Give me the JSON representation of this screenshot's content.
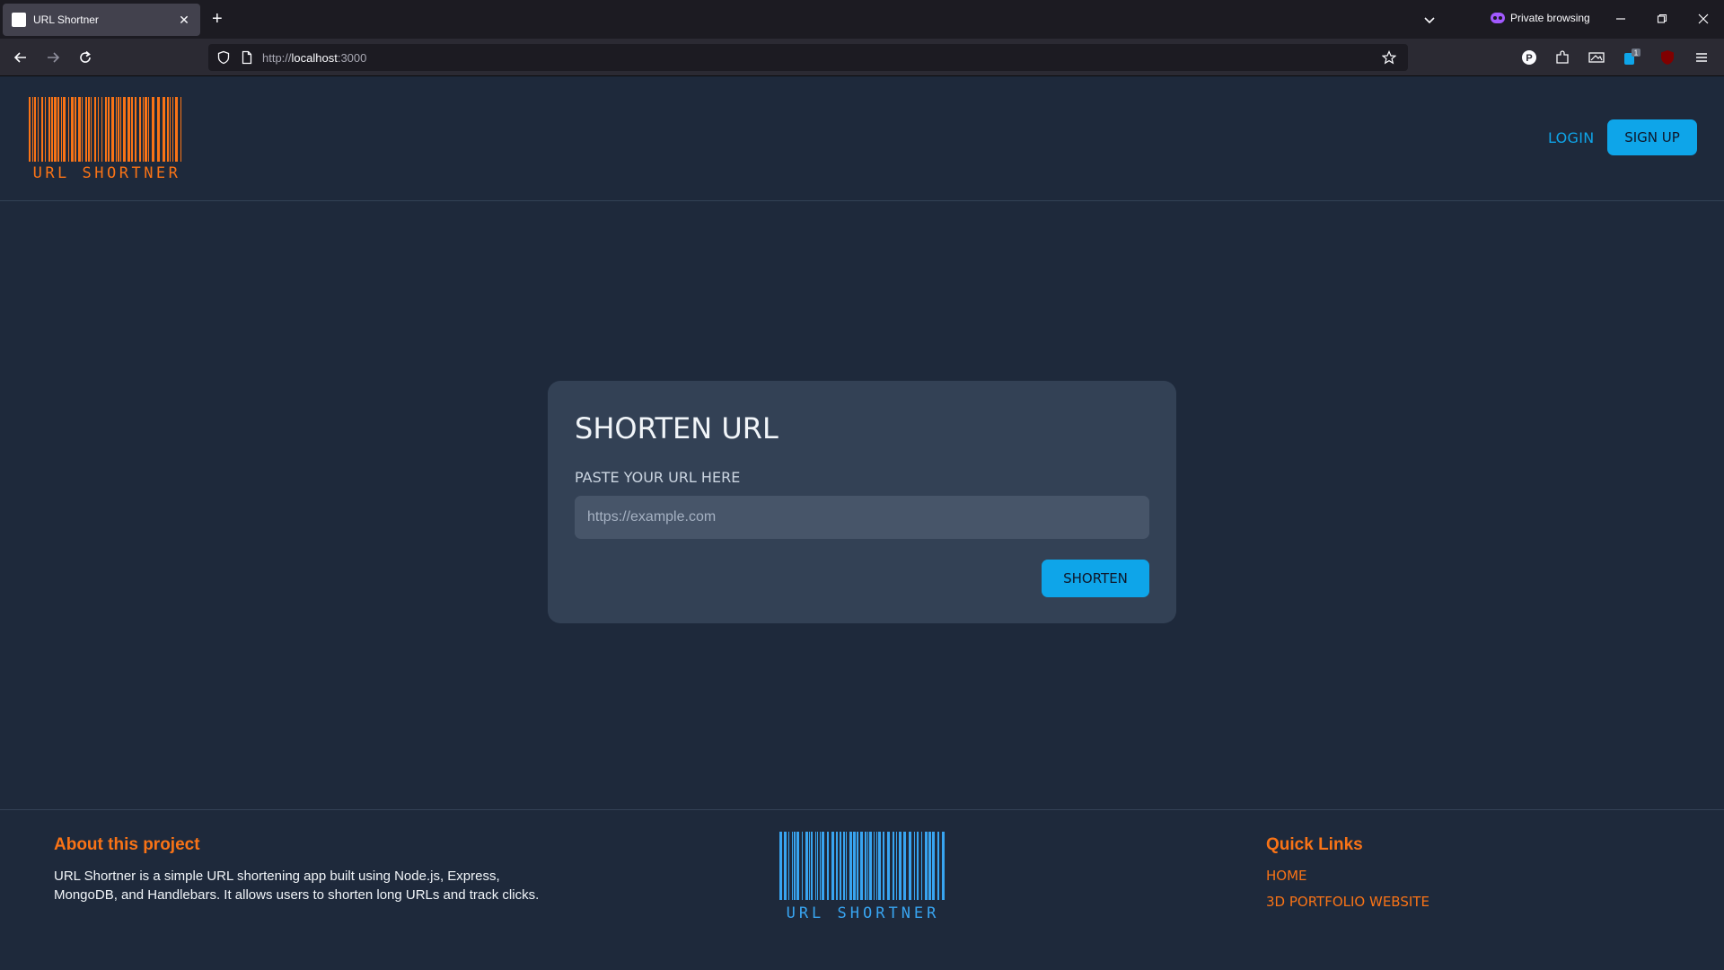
{
  "browser": {
    "tab_title": "URL Shortner",
    "tab_close": "✕",
    "new_tab": "+",
    "private_label": "Private browsing",
    "url_scheme": "http://",
    "url_host": "localhost",
    "url_port": ":3000",
    "extension_badge": "1"
  },
  "header": {
    "logo_text": "URL SHORTNER",
    "logo_color": "#f97316",
    "login_label": "LOGIN",
    "signup_label": "SIGN UP"
  },
  "form": {
    "title": "SHORTEN URL",
    "label": "PASTE YOUR URL HERE",
    "placeholder": "https://example.com",
    "value": "",
    "submit_label": "SHORTEN"
  },
  "footer": {
    "about_title": "About this project",
    "about_text": "URL Shortner is a simple URL shortening app built using Node.js, Express, MongoDB, and Handlebars. It allows users to shorten long URLs and track clicks.",
    "logo_text": "URL SHORTNER",
    "logo_color": "#38a4f0",
    "quick_links_title": "Quick Links",
    "links": [
      {
        "label": "HOME"
      },
      {
        "label": "3D PORTFOLIO WEBSITE"
      }
    ]
  },
  "colors": {
    "accent": "#0ea5e9",
    "highlight": "#f97316",
    "background": "#1e293b",
    "card": "#334155"
  }
}
